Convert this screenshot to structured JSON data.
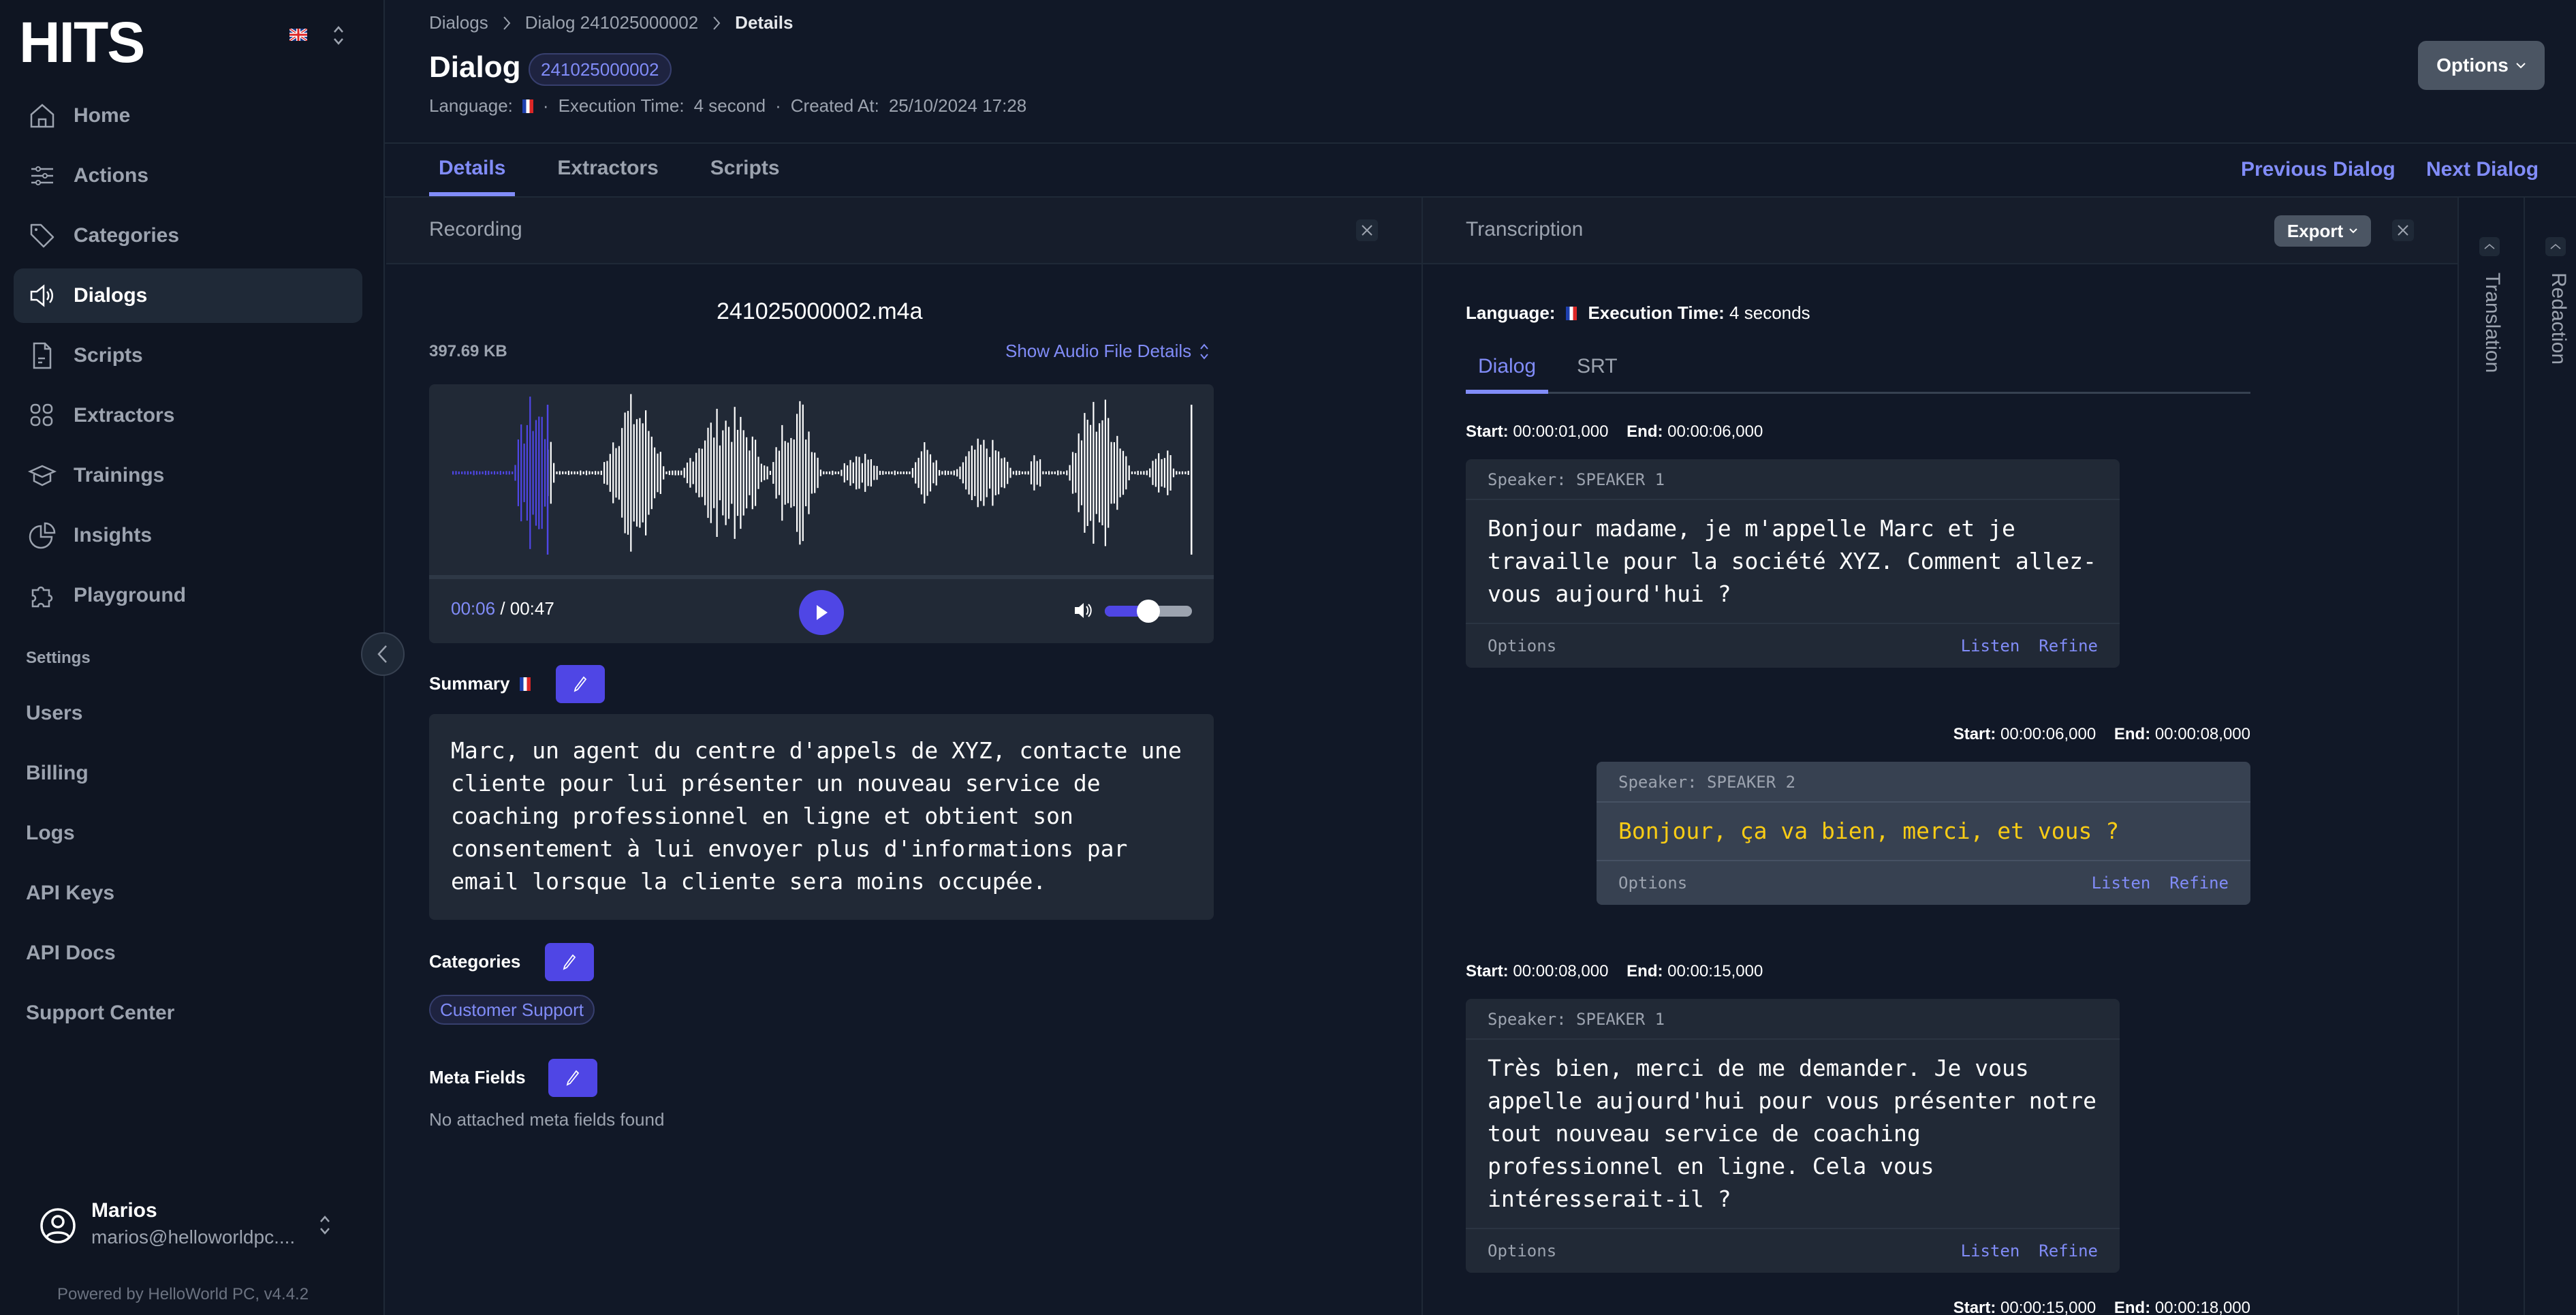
{
  "sidebar": {
    "logo_text": "HITS",
    "language_flag": "uk-flag",
    "nav": [
      {
        "label": "Home",
        "icon": "home-icon"
      },
      {
        "label": "Actions",
        "icon": "sliders-icon"
      },
      {
        "label": "Categories",
        "icon": "tag-icon"
      },
      {
        "label": "Dialogs",
        "icon": "speaker-icon",
        "active": true
      },
      {
        "label": "Scripts",
        "icon": "document-icon"
      },
      {
        "label": "Extractors",
        "icon": "grid-icon"
      },
      {
        "label": "Trainings",
        "icon": "graduation-cap-icon"
      },
      {
        "label": "Insights",
        "icon": "pie-chart-icon"
      },
      {
        "label": "Playground",
        "icon": "puzzle-icon"
      }
    ],
    "settings_heading": "Settings",
    "settings_items": [
      "Users",
      "Billing",
      "Logs",
      "API Keys",
      "API Docs",
      "Support Center"
    ],
    "user": {
      "name": "Marios",
      "email": "marios@helloworldpc...."
    },
    "powered_by": "Powered by HelloWorld PC, v4.4.2"
  },
  "header": {
    "breadcrumb": [
      "Dialogs",
      "Dialog 241025000002",
      "Details"
    ],
    "title": "Dialog",
    "dialog_id": "241025000002",
    "meta": {
      "language_label": "Language:",
      "language_flag": "fr-flag",
      "execution_label": "Execution Time:",
      "execution_value": "4 second",
      "created_label": "Created At:",
      "created_value": "25/10/2024 17:28"
    },
    "options_label": "Options"
  },
  "tabs": [
    {
      "label": "Details",
      "active": true
    },
    {
      "label": "Extractors"
    },
    {
      "label": "Scripts"
    }
  ],
  "nav_links": {
    "previous": "Previous Dialog",
    "next": "Next Dialog"
  },
  "recording": {
    "title": "Recording",
    "filename": "241025000002.m4a",
    "filesize": "397.69 KB",
    "show_details": "Show Audio File Details",
    "current_time": "00:06",
    "total_time": "00:47",
    "progress": 0.128,
    "volume": 0.5,
    "accent": "#4f46e5"
  },
  "summary": {
    "label": "Summary",
    "text": "Marc, un agent du centre d'appels de XYZ, contacte une cliente pour lui présenter un nouveau service de coaching professionnel en ligne et obtient son consentement à lui envoyer plus d'informations par email lorsque la cliente sera moins occupée."
  },
  "categories": {
    "label": "Categories",
    "items": [
      "Customer Support"
    ]
  },
  "meta_fields": {
    "label": "Meta Fields",
    "empty_text": "No attached meta fields found"
  },
  "transcription": {
    "title": "Transcription",
    "export_label": "Export",
    "language_label": "Language:",
    "execution_label": "Execution Time:",
    "execution_value": "4 seconds",
    "tabs": [
      {
        "label": "Dialog",
        "active": true
      },
      {
        "label": "SRT"
      }
    ],
    "start_label": "Start:",
    "end_label": "End:",
    "options_label": "Options",
    "listen_label": "Listen",
    "refine_label": "Refine",
    "segments": [
      {
        "speaker": "Speaker: SPEAKER 1",
        "start": "00:00:01,000",
        "end": "00:00:06,000",
        "text": "Bonjour madame, je m'appelle Marc et je travaille pour la société XYZ. Comment allez-vous aujourd'hui ?"
      },
      {
        "speaker": "Speaker: SPEAKER 2",
        "start": "00:00:06,000",
        "end": "00:00:08,000",
        "text": "Bonjour, ça va bien, merci, et vous ?"
      },
      {
        "speaker": "Speaker: SPEAKER 1",
        "start": "00:00:08,000",
        "end": "00:00:15,000",
        "text": "Très bien, merci de me demander. Je vous appelle aujourd'hui pour vous présenter notre tout nouveau service de coaching professionnel en ligne. Cela vous intéresserait-il ?"
      },
      {
        "speaker": "",
        "start": "00:00:15,000",
        "end": "00:00:18,000",
        "text": ""
      }
    ]
  },
  "side_panels": [
    "Translation",
    "Redaction"
  ]
}
